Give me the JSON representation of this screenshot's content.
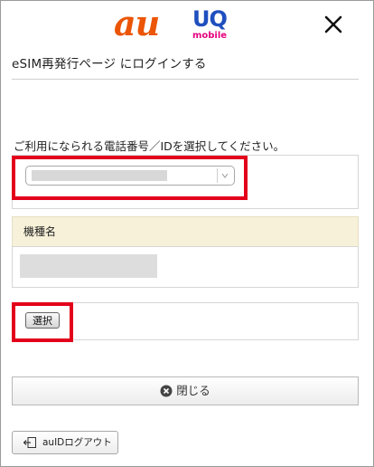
{
  "header": {
    "au_logo": "au",
    "uq_logo": "UQ",
    "uq_sub": "mobile",
    "close_icon": "close-icon"
  },
  "page_title": "eSIM再発行ページ にログインする",
  "instruction": "ご利用になられる電話番号／IDを選択してください。",
  "phone_select": {
    "icon": "chevron-down-icon"
  },
  "model": {
    "header": "機種名"
  },
  "select_button": "選択",
  "close_button": {
    "label": "閉じる",
    "icon": "close-circle-icon"
  },
  "logout_button": {
    "label": "auIDログアウト",
    "icon": "logout-icon"
  },
  "colors": {
    "au_orange": "#eb5505",
    "uq_blue": "#1f4fbf",
    "uq_pink": "#e6007e",
    "highlight_red": "#e3001b",
    "model_header_bg": "#f7f1d9"
  }
}
